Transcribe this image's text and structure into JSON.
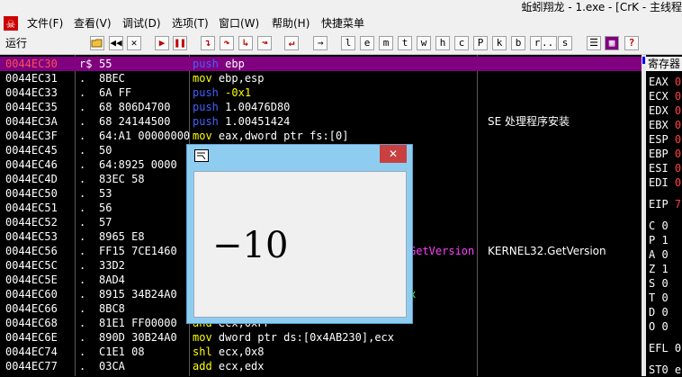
{
  "window": {
    "title": "蚯蚓翔龙 - 1.exe - [CrK - 主线程"
  },
  "menu": [
    "文件(F)",
    "查看(V)",
    "调试(D)",
    "选项(T)",
    "窗口(W)",
    "帮助(H)",
    "快捷菜单"
  ],
  "toolbar": {
    "status": "运行",
    "buttons": [
      "l",
      "e",
      "m",
      "t",
      "w",
      "h",
      "c",
      "P",
      "k",
      "b",
      "r",
      "...",
      "s",
      "?"
    ]
  },
  "disasm": {
    "rows": [
      {
        "addr": "0044EC30",
        "mark": "r$",
        "hex": "55",
        "mn": "push",
        "op": "ebp",
        "cmt": "",
        "sel": true
      },
      {
        "addr": "0044EC31",
        "mark": ".",
        "hex": "8BEC",
        "mn": "mov",
        "op": "ebp,esp",
        "cmt": ""
      },
      {
        "addr": "0044EC33",
        "mark": ".",
        "hex": "6A FF",
        "mn": "push",
        "op": "-0x1",
        "cmt": ""
      },
      {
        "addr": "0044EC35",
        "mark": ".",
        "hex": "68 806D4700",
        "mn": "push",
        "op": "1.00476D80",
        "cmt": ""
      },
      {
        "addr": "0044EC3A",
        "mark": ".",
        "hex": "68 24144500",
        "mn": "push",
        "op": "1.00451424",
        "cmt": "SE 处理程序安装"
      },
      {
        "addr": "0044EC3F",
        "mark": ".",
        "hex": "64:A1 00000000",
        "mn": "mov",
        "op": "eax,dword ptr fs:[0]",
        "cmt": ""
      },
      {
        "addr": "0044EC45",
        "mark": ".",
        "hex": "50",
        "mn": "",
        "op": "",
        "cmt": ""
      },
      {
        "addr": "0044EC46",
        "mark": ".",
        "hex": "64:8925 0000",
        "mn": "",
        "op": "",
        "cmt": ""
      },
      {
        "addr": "0044EC4D",
        "mark": ".",
        "hex": "83EC 58",
        "mn": "",
        "op": "",
        "cmt": ""
      },
      {
        "addr": "0044EC50",
        "mark": ".",
        "hex": "53",
        "mn": "",
        "op": "",
        "cmt": ""
      },
      {
        "addr": "0044EC51",
        "mark": ".",
        "hex": "56",
        "mn": "",
        "op": "",
        "cmt": ""
      },
      {
        "addr": "0044EC52",
        "mark": ".",
        "hex": "57",
        "mn": "",
        "op": "",
        "cmt": ""
      },
      {
        "addr": "0044EC53",
        "mark": ".",
        "hex": "8965 E8",
        "mn": "",
        "op": "",
        "cmt": ""
      },
      {
        "addr": "0044EC56",
        "mark": ".",
        "hex": "FF15 7CE1460",
        "mn": "",
        "op": "GetVersion",
        "cmt": "KERNEL32.GetVersion"
      },
      {
        "addr": "0044EC5C",
        "mark": ".",
        "hex": "33D2",
        "mn": "",
        "op": "",
        "cmt": ""
      },
      {
        "addr": "0044EC5E",
        "mark": ".",
        "hex": "8AD4",
        "mn": "",
        "op": "",
        "cmt": ""
      },
      {
        "addr": "0044EC60",
        "mark": ".",
        "hex": "8915 34B24A0",
        "mn": "",
        "op": "x",
        "cmt": ""
      },
      {
        "addr": "0044EC66",
        "mark": ".",
        "hex": "8BC8",
        "mn": "",
        "op": "",
        "cmt": ""
      },
      {
        "addr": "0044EC68",
        "mark": ".",
        "hex": "81E1 FF00000",
        "mn": "and",
        "op": "ecx,0xFF",
        "cmt": ""
      },
      {
        "addr": "0044EC6E",
        "mark": ".",
        "hex": "890D 30B24A0",
        "mn": "mov",
        "op": "dword ptr ds:[0x4AB230],ecx",
        "cmt": ""
      },
      {
        "addr": "0044EC74",
        "mark": ".",
        "hex": "C1E1 08",
        "mn": "shl",
        "op": "ecx,0x8",
        "cmt": ""
      },
      {
        "addr": "0044EC77",
        "mark": ".",
        "hex": "03CA",
        "mn": "add",
        "op": "ecx,edx",
        "cmt": ""
      }
    ]
  },
  "registers": {
    "title": "寄存器",
    "rows": [
      {
        "name": "EAX",
        "val": "0"
      },
      {
        "name": "ECX",
        "val": "0"
      },
      {
        "name": "EDX",
        "val": "0"
      },
      {
        "name": "EBX",
        "val": "0"
      },
      {
        "name": "ESP",
        "val": "0"
      },
      {
        "name": "EBP",
        "val": "0"
      },
      {
        "name": "ESI",
        "val": "0"
      },
      {
        "name": "EDI",
        "val": "0"
      },
      {
        "name": "EIP",
        "val": "7"
      },
      {
        "name": "C",
        "val": "0"
      },
      {
        "name": "P",
        "val": "1"
      },
      {
        "name": "A",
        "val": "0"
      },
      {
        "name": "Z",
        "val": "1"
      },
      {
        "name": "S",
        "val": "0"
      },
      {
        "name": "T",
        "val": "0"
      },
      {
        "name": "D",
        "val": "0"
      },
      {
        "name": "O",
        "val": "0"
      },
      {
        "name": "EFL",
        "val": "0"
      },
      {
        "name": "ST0",
        "val": "e"
      }
    ]
  },
  "popup": {
    "close": "✕",
    "value": "−10"
  },
  "colors": {
    "selected_row": "#800080",
    "mnemonic_yellow": "#ffff00",
    "mnemonic_blue": "#4060ff",
    "mnemonic_magenta": "#ff40ff"
  }
}
